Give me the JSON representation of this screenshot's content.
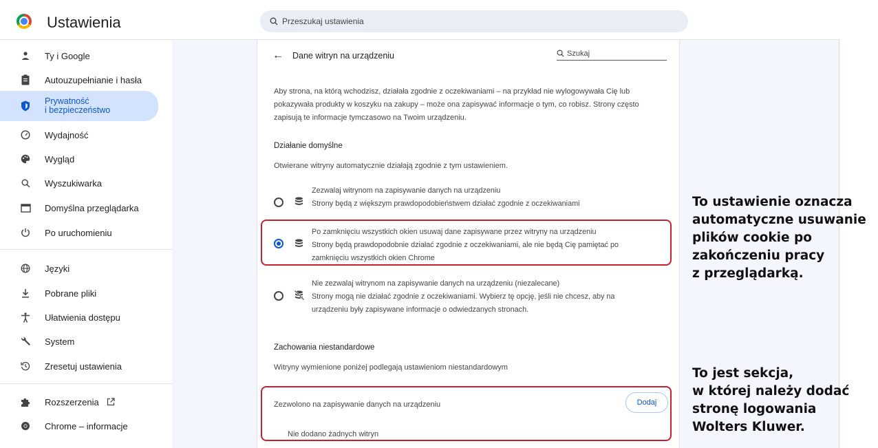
{
  "app": {
    "title": "Ustawienia",
    "search_placeholder": "Przeszukaj ustawienia"
  },
  "sidebar": {
    "items": [
      {
        "label": "Ty i Google",
        "icon": "person-icon"
      },
      {
        "label": "Autouzupełnianie i hasła",
        "icon": "clipboard-icon"
      },
      {
        "label_line1": "Prywatność",
        "label_line2": "i bezpieczeństwo",
        "icon": "shield-icon",
        "active": true
      },
      {
        "label": "Wydajność",
        "icon": "speedometer-icon"
      },
      {
        "label": "Wygląd",
        "icon": "palette-icon"
      },
      {
        "label": "Wyszukiwarka",
        "icon": "search-icon"
      },
      {
        "label": "Domyślna przeglądarka",
        "icon": "browser-icon"
      },
      {
        "label": "Po uruchomieniu",
        "icon": "power-icon"
      },
      {
        "label": "Języki",
        "icon": "globe-icon"
      },
      {
        "label": "Pobrane pliki",
        "icon": "download-icon"
      },
      {
        "label": "Ułatwienia dostępu",
        "icon": "accessibility-icon"
      },
      {
        "label": "System",
        "icon": "wrench-icon"
      },
      {
        "label": "Zresetuj ustawienia",
        "icon": "reset-icon"
      },
      {
        "label": "Rozszerzenia",
        "icon": "puzzle-icon"
      },
      {
        "label": "Chrome – informacje",
        "icon": "chrome-icon"
      }
    ]
  },
  "page": {
    "title": "Dane witryn na urządzeniu",
    "search_placeholder": "Szukaj",
    "description_l1": "Aby strona, na którą wchodzisz, działała zgodnie z oczekiwaniami – na przykład nie wylogowywała Cię lub",
    "description_l2": "pokazywała produkty w koszyku na zakupy – może ona zapisywać informacje o tym, co robisz. Strony często",
    "description_l3": "zapisują te informacje tymczasowo na Twoim urządzeniu.",
    "default_title": "Działanie domyślne",
    "default_sub": "Otwierane witryny automatycznie działają zgodnie z tym ustawieniem.",
    "options": [
      {
        "l1": "Zezwalaj witrynom na zapisywanie danych na urządzeniu",
        "l2": "Strony będą z większym prawdopodobieństwem działać zgodnie z oczekiwaniami"
      },
      {
        "l1": "Po zamknięciu wszystkich okien usuwaj dane zapisywane przez witryny na urządzeniu",
        "l2": "Strony będą prawdopodobnie działać zgodnie z oczekiwaniami, ale nie będą Cię pamiętać po",
        "l3": "zamknięciu wszystkich okien Chrome",
        "selected": true
      },
      {
        "l1": "Nie zezwalaj witrynom na zapisywanie danych na urządzeniu (niezalecane)",
        "l2": "Strony mogą nie działać zgodnie z oczekiwaniami. Wybierz tę opcję, jeśli nie chcesz, aby na",
        "l3": "urządzeniu były zapisywane informacje o odwiedzanych stronach."
      }
    ],
    "custom_title": "Zachowania niestandardowe",
    "custom_sub": "Witryny wymienione poniżej podlegają ustawieniom niestandardowym",
    "allowed_label": "Zezwolono na zapisywanie danych na urządzeniu",
    "add_label": "Dodaj",
    "empty_label": "Nie dodano żadnych witryn"
  },
  "annotations": {
    "a1": [
      "To ustawienie oznacza",
      "automatyczne usuwanie",
      "plików cookie po",
      "zakończeniu pracy",
      "z przeglądarką."
    ],
    "a2": [
      "To jest sekcja,",
      "w której należy dodać",
      "stronę logowania",
      "Wolters Kluwer."
    ]
  },
  "colors": {
    "accent": "#0b57d0",
    "highlight": "#c8202f",
    "active_bg": "#d3e3fd"
  }
}
